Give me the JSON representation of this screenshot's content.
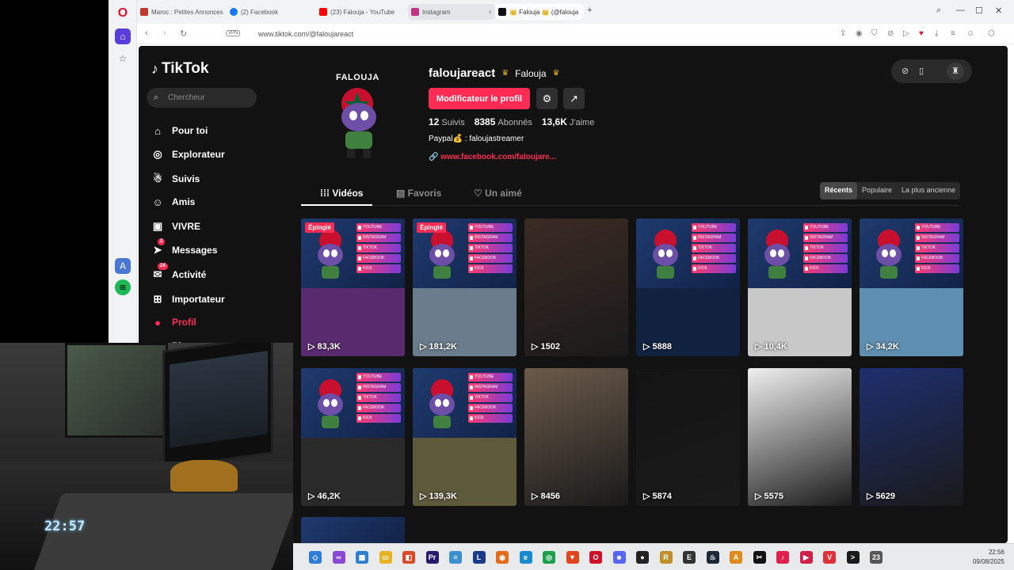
{
  "browser": {
    "tabs": [
      {
        "label": "Maroc : Petites Annonces",
        "color": "#c0392b"
      },
      {
        "label": "(2) Facebook",
        "color": "#1877f2"
      },
      {
        "label": "(23) Falouja - YouTube",
        "color": "#ff0000"
      },
      {
        "label": "Instagram",
        "color": "#c13584"
      },
      {
        "label": "👑 Falouja 👑 (@falouja",
        "color": "#111111"
      }
    ],
    "url": "www.tiktok.com/@faloujareact",
    "vpn": "VPN"
  },
  "sidebar": {
    "logo": "TikTok",
    "search_placeholder": "Chercheur",
    "items": [
      {
        "label": "Pour toi",
        "icon": "home-icon",
        "glyph": "⌂"
      },
      {
        "label": "Explorateur",
        "icon": "compass-icon",
        "glyph": "◎"
      },
      {
        "label": "Suivis",
        "icon": "user-follow-icon",
        "glyph": "☃"
      },
      {
        "label": "Amis",
        "icon": "friends-icon",
        "glyph": "☺"
      },
      {
        "label": "VIVRE",
        "icon": "live-icon",
        "glyph": "▣"
      },
      {
        "label": "Messages",
        "icon": "paper-plane-icon",
        "glyph": "➤",
        "badge": "2"
      },
      {
        "label": "Activité",
        "icon": "inbox-icon",
        "glyph": "✉",
        "badge": "24"
      },
      {
        "label": "Importateur",
        "icon": "upload-icon",
        "glyph": "⊞"
      },
      {
        "label": "Profil",
        "icon": "profile-icon",
        "glyph": "●"
      },
      {
        "label": "Plus",
        "icon": "more-icon",
        "glyph": "⋯"
      }
    ]
  },
  "profile": {
    "avatar_title": "FALOUJA",
    "handle": "faloujareact",
    "display_name": "Falouja",
    "edit_label": "Modificateur le profil",
    "following_count": "12",
    "following_label": "Suivis",
    "followers_count": "8385",
    "followers_label": "Abonnés",
    "likes_count": "13,6K",
    "likes_label": "J'aime",
    "bio": "Paypal💰 : faloujastreamer",
    "link": "www.facebook.com/faloujare..."
  },
  "content_tabs": {
    "videos": "Vidéos",
    "favorites": "Favoris",
    "liked": "Un aimé"
  },
  "sort": {
    "recent": "Récents",
    "popular": "Populaire",
    "oldest": "La plus ancienne"
  },
  "videos": [
    {
      "views": "83,3K",
      "pinned": "Épinglé",
      "bottom": "#5a2a6e"
    },
    {
      "views": "181,2K",
      "pinned": "Épinglé",
      "bottom": "#6b7c8c"
    },
    {
      "views": "1502",
      "bottom": "#3b2a24"
    },
    {
      "views": "5888",
      "bottom": "#10223f"
    },
    {
      "views": "10,4K",
      "bottom": "#c8c8c8"
    },
    {
      "views": "34,2K",
      "bottom": "#5f8fb0"
    },
    {
      "views": "46,2K",
      "bottom": "#2a2a2a"
    },
    {
      "views": "139,3K",
      "bottom": "#5c5a3a"
    },
    {
      "views": "8456",
      "bottom": "#6b5a4a"
    },
    {
      "views": "5874",
      "bottom": "#141414"
    },
    {
      "views": "5575",
      "bottom": "#f0f0f0"
    },
    {
      "views": "5629",
      "bottom": "#1e2f6e"
    }
  ],
  "menu_labels": [
    "YOUTUBE",
    "INSTAGRAM",
    "TIKTOK",
    "FACEBOOK",
    "KICK"
  ],
  "webcam": {
    "clock": "22:57"
  },
  "taskbar": {
    "time": "22:56",
    "date": "09/08/2025",
    "badge": "23"
  }
}
